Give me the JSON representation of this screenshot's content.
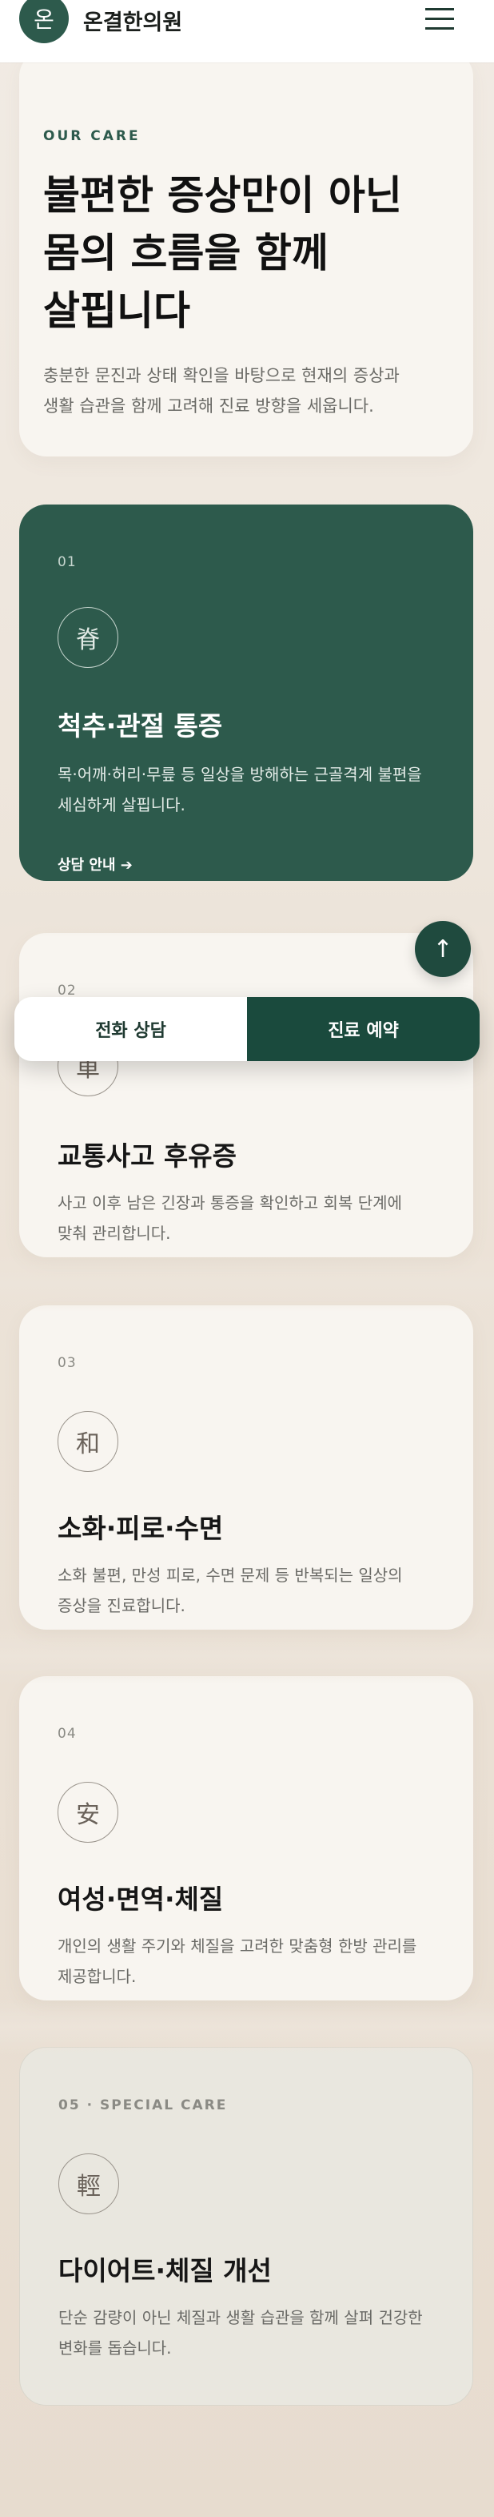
{
  "header": {
    "logo_char": "온",
    "brand": "온결한의원",
    "menu_icon": "hamburger-icon"
  },
  "intro": {
    "eyebrow": "OUR CARE",
    "title_lines": [
      "불편한 증상만이 아닌",
      "몸의 흐름을 함께",
      "살핍니다"
    ],
    "desc_lines": [
      "충분한 문진과 상태 확인을 바탕으로 현재의 증상과",
      "생활 습관을 함께 고려해 진료 방향을 세웁니다."
    ]
  },
  "cards": [
    {
      "num": "01",
      "hanja": "脊",
      "title": "척추·관절 통증",
      "desc_lines": [
        "목·어깨·허리·무릎 등 일상을 방해하는 근골격계 불편을",
        "세심하게 살핍니다."
      ],
      "link": "상담 안내 ➔"
    },
    {
      "num": "02",
      "hanja": "車",
      "title": "교통사고 후유증",
      "desc_lines": [
        "사고 이후 남은 긴장과 통증을 확인하고 회복 단계에",
        "맞춰 관리합니다."
      ]
    },
    {
      "num": "03",
      "hanja": "和",
      "title": "소화·피로·수면",
      "desc_lines": [
        "소화 불편, 만성 피로, 수면 문제 등 반복되는 일상의",
        "증상을 진료합니다."
      ]
    },
    {
      "num": "04",
      "hanja": "安",
      "title": "여성·면역·체질",
      "desc_lines": [
        "개인의 생활 주기와 체질을 고려한 맞춤형 한방 관리를",
        "제공합니다."
      ]
    },
    {
      "num": "05 · SPECIAL CARE",
      "hanja": "輕",
      "title": "다이어트·체질 개선",
      "desc_lines": [
        "단순 감량이 아닌 체질과 생활 습관을 함께 살펴 건강한",
        "변화를 돕습니다."
      ]
    }
  ],
  "floating": {
    "top_icon": "arrow-up-icon",
    "top_glyph": "↑"
  },
  "cta": {
    "phone": "전화 상담",
    "book": "진료 예약"
  },
  "colors": {
    "primary": "#2d5a4c",
    "dark": "#1a4a3d",
    "card": "#f8f5f0",
    "background": "#ece4da"
  }
}
